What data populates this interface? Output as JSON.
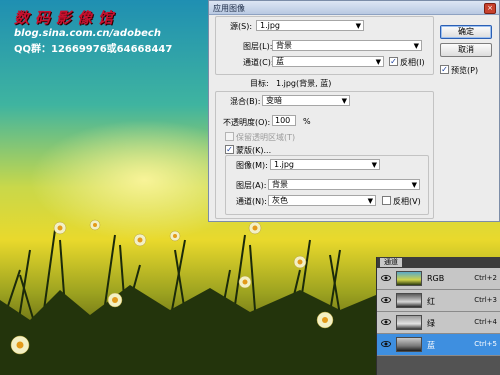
{
  "watermark": {
    "title": "数码影像馆",
    "blog": "blog.sina.com.cn/adobech",
    "qq": "QQ群：12669976或64668447"
  },
  "dialog": {
    "title": "应用图像",
    "source_label": "源(S):",
    "source_value": "1.jpg",
    "layer_label": "图层(L):",
    "layer_value": "背景",
    "channel_label": "通道(C):",
    "channel_value": "蓝",
    "invert_label": "反相(I)",
    "invert_checked": true,
    "target_label": "目标:",
    "target_value": "1.jpg(背景, 蓝)",
    "blending_label": "混合(B):",
    "blending_value": "变暗",
    "opacity_label": "不透明度(O):",
    "opacity_value": "100",
    "opacity_unit": "%",
    "preserve_label": "保留透明区域(T)",
    "mask_label": "蒙版(K)...",
    "mask_checked": true,
    "mask_image_label": "图像(M):",
    "mask_image_value": "1.jpg",
    "mask_layer_label": "图层(A):",
    "mask_layer_value": "背景",
    "mask_channel_label": "通道(N):",
    "mask_channel_value": "灰色",
    "mask_invert_label": "反相(V)",
    "ok_label": "确定",
    "cancel_label": "取消",
    "preview_label": "预览(P)",
    "preview_checked": true,
    "close_glyph": "×",
    "check_glyph": "✓",
    "arrow_glyph": "▼"
  },
  "channels": {
    "tab_label": "通道",
    "rows": [
      {
        "name": "RGB",
        "shortcut": "Ctrl+2",
        "selected": false
      },
      {
        "name": "红",
        "shortcut": "Ctrl+3",
        "selected": false
      },
      {
        "name": "绿",
        "shortcut": "Ctrl+4",
        "selected": false
      },
      {
        "name": "蓝",
        "shortcut": "Ctrl+5",
        "selected": true
      }
    ]
  },
  "colors": {
    "selected_row": "#3e8fe0",
    "watermark_title": "#c8102e"
  }
}
